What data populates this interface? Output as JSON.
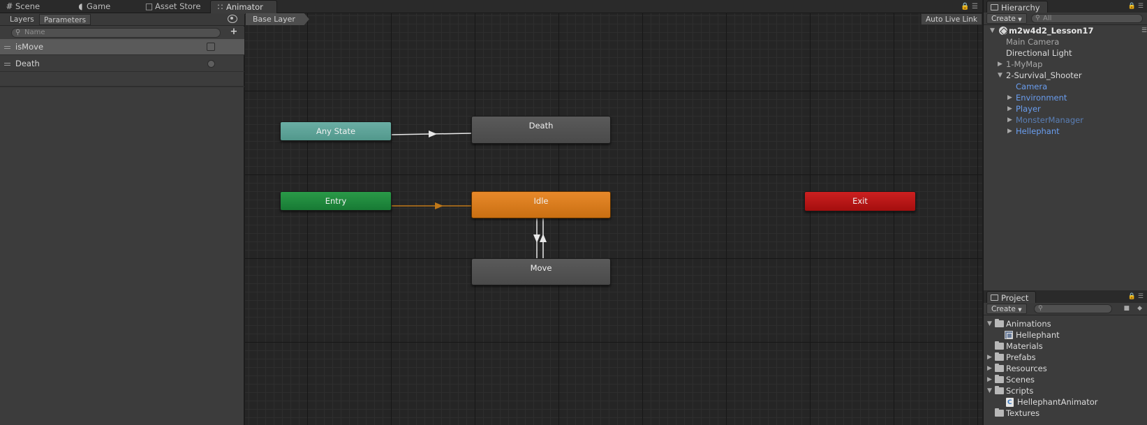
{
  "tabs": [
    {
      "label": "Scene",
      "icon": "grid-icon"
    },
    {
      "label": "Game",
      "icon": "pacman-icon"
    },
    {
      "label": "Asset Store",
      "icon": "bag-icon"
    },
    {
      "label": "Animator",
      "icon": "animator-icon",
      "active": true
    }
  ],
  "animator": {
    "subtabs": {
      "layers": "Layers",
      "parameters": "Parameters"
    },
    "search_placeholder": "Name",
    "parameters": [
      {
        "name": "isMove",
        "type": "bool",
        "selected": true
      },
      {
        "name": "Death",
        "type": "trigger",
        "selected": false
      }
    ],
    "breadcrumb": "Base Layer",
    "auto_live_link": "Auto Live Link",
    "states": {
      "any_state": "Any State",
      "death": "Death",
      "entry": "Entry",
      "idle": "Idle",
      "exit": "Exit",
      "move": "Move"
    },
    "colors": {
      "any_state": "#5ea39a",
      "entry": "#1f8a3e",
      "idle": "#d97c1e",
      "exit": "#b81616",
      "default_state": "#525252",
      "transition": "#e8e8e8",
      "default_transition": "#c07818"
    }
  },
  "hierarchy": {
    "tab_label": "Hierarchy",
    "create_label": "Create",
    "search_placeholder": "All",
    "scene": "m2w4d2_Lesson17",
    "items": [
      {
        "label": "Main Camera",
        "depth": 1,
        "expandable": false,
        "color": "gray"
      },
      {
        "label": "Directional Light",
        "depth": 1,
        "expandable": false,
        "color": "white"
      },
      {
        "label": "1-MyMap",
        "depth": 1,
        "expandable": true,
        "expanded": false,
        "color": "gray"
      },
      {
        "label": "2-Survival_Shooter",
        "depth": 1,
        "expandable": true,
        "expanded": true,
        "color": "white"
      },
      {
        "label": "Camera",
        "depth": 2,
        "expandable": false,
        "color": "blue"
      },
      {
        "label": "Environment",
        "depth": 2,
        "expandable": true,
        "expanded": false,
        "color": "blue"
      },
      {
        "label": "Player",
        "depth": 2,
        "expandable": true,
        "expanded": false,
        "color": "blue"
      },
      {
        "label": "MonsterManager",
        "depth": 2,
        "expandable": true,
        "expanded": false,
        "color": "blue-dim"
      },
      {
        "label": "Hellephant",
        "depth": 2,
        "expandable": true,
        "expanded": false,
        "color": "blue"
      }
    ]
  },
  "project": {
    "tab_label": "Project",
    "create_label": "Create",
    "search_placeholder": "",
    "items": [
      {
        "label": "Animations",
        "depth": 0,
        "icon": "folder-icon",
        "expandable": true,
        "expanded": true
      },
      {
        "label": "Hellephant",
        "depth": 1,
        "icon": "animator-controller-icon",
        "expandable": false
      },
      {
        "label": "Materials",
        "depth": 0,
        "icon": "folder-icon",
        "expandable": false
      },
      {
        "label": "Prefabs",
        "depth": 0,
        "icon": "folder-icon",
        "expandable": true,
        "expanded": false
      },
      {
        "label": "Resources",
        "depth": 0,
        "icon": "folder-icon",
        "expandable": true,
        "expanded": false
      },
      {
        "label": "Scenes",
        "depth": 0,
        "icon": "folder-icon",
        "expandable": true,
        "expanded": false
      },
      {
        "label": "Scripts",
        "depth": 0,
        "icon": "folder-icon",
        "expandable": true,
        "expanded": true
      },
      {
        "label": "HellephantAnimator",
        "depth": 1,
        "icon": "csharp-script-icon",
        "expandable": false
      },
      {
        "label": "Textures",
        "depth": 0,
        "icon": "folder-icon",
        "expandable": false
      }
    ]
  }
}
